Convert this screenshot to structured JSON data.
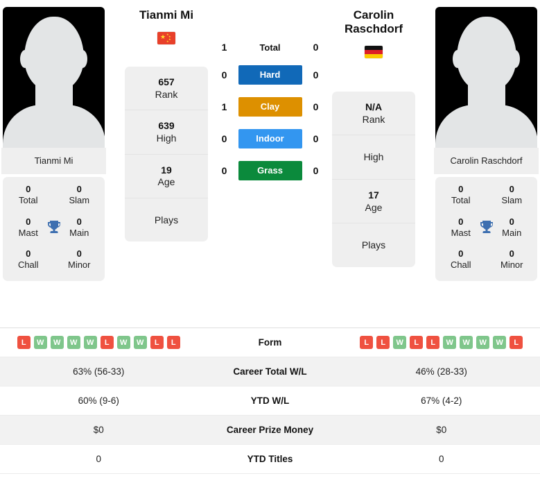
{
  "players": {
    "left": {
      "name": "Tianmi Mi",
      "photo_caption": "Tianmi Mi",
      "flag": "cn-flag-icon",
      "stats": [
        {
          "value": "657",
          "label": "Rank"
        },
        {
          "value": "639",
          "label": "High"
        },
        {
          "value": "19",
          "label": "Age"
        },
        {
          "value": "",
          "label": "Plays"
        }
      ],
      "titles": [
        {
          "value": "0",
          "label": "Total"
        },
        {
          "value": "0",
          "label": "Slam"
        },
        {
          "value": "0",
          "label": "Mast"
        },
        {
          "value": "0",
          "label": "Main"
        },
        {
          "value": "0",
          "label": "Chall"
        },
        {
          "value": "0",
          "label": "Minor"
        }
      ],
      "form": [
        "L",
        "W",
        "W",
        "W",
        "W",
        "L",
        "W",
        "W",
        "L",
        "L"
      ],
      "career_total_wl": "63% (56-33)",
      "ytd_wl": "60% (9-6)",
      "career_prize_money": "$0",
      "ytd_titles": "0"
    },
    "right": {
      "name": "Carolin Raschdorf",
      "photo_caption": "Carolin Raschdorf",
      "flag": "de-flag-icon",
      "stats": [
        {
          "value": "N/A",
          "label": "Rank"
        },
        {
          "value": "",
          "label": "High"
        },
        {
          "value": "17",
          "label": "Age"
        },
        {
          "value": "",
          "label": "Plays"
        }
      ],
      "titles": [
        {
          "value": "0",
          "label": "Total"
        },
        {
          "value": "0",
          "label": "Slam"
        },
        {
          "value": "0",
          "label": "Mast"
        },
        {
          "value": "0",
          "label": "Main"
        },
        {
          "value": "0",
          "label": "Chall"
        },
        {
          "value": "0",
          "label": "Minor"
        }
      ],
      "form": [
        "L",
        "L",
        "W",
        "L",
        "L",
        "W",
        "W",
        "W",
        "W",
        "L"
      ],
      "career_total_wl": "46% (28-33)",
      "ytd_wl": "67% (4-2)",
      "career_prize_money": "$0",
      "ytd_titles": "0"
    }
  },
  "head_to_head": [
    {
      "label": "Total",
      "left": "1",
      "right": "0",
      "style": "plain",
      "color": ""
    },
    {
      "label": "Hard",
      "left": "0",
      "right": "0",
      "style": "badge",
      "color": "#1169b8"
    },
    {
      "label": "Clay",
      "left": "1",
      "right": "0",
      "style": "badge",
      "color": "#dd9000"
    },
    {
      "label": "Indoor",
      "left": "0",
      "right": "0",
      "style": "badge",
      "color": "#3396f0"
    },
    {
      "label": "Grass",
      "left": "0",
      "right": "0",
      "style": "badge",
      "color": "#0b8a3c"
    }
  ],
  "comparison_rows": [
    {
      "label": "Form",
      "left": "",
      "right": ""
    },
    {
      "label": "Career Total W/L",
      "left": "63% (56-33)",
      "right": "46% (28-33)"
    },
    {
      "label": "YTD W/L",
      "left": "60% (9-6)",
      "right": "67% (4-2)"
    },
    {
      "label": "Career Prize Money",
      "left": "$0",
      "right": "$0"
    },
    {
      "label": "YTD Titles",
      "left": "0",
      "right": "0"
    }
  ],
  "colors": {
    "win": "#7fc68b",
    "loss": "#ef5140",
    "trophy": "#3d6fb0",
    "card_bg": "#efefef"
  }
}
